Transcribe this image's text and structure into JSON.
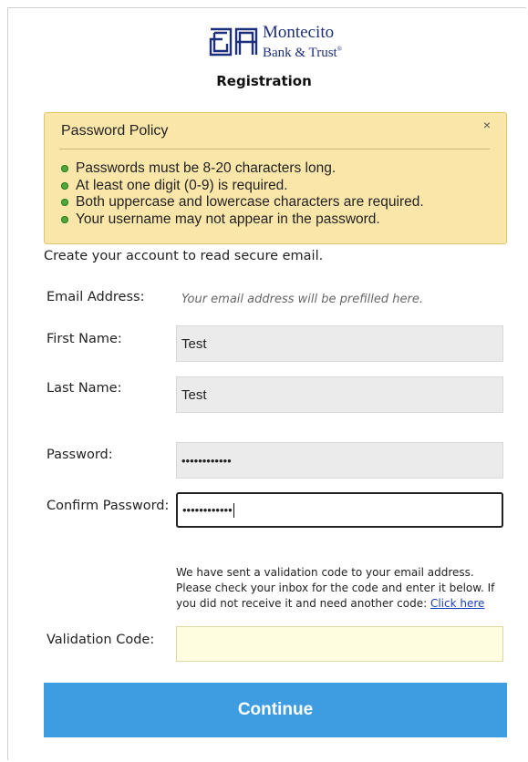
{
  "brand": {
    "line1": "Montecito",
    "line2": "Bank & Trust",
    "registered_mark": "®",
    "color": "#1e2f7a"
  },
  "page_title": "Registration",
  "policy": {
    "title": "Password Policy",
    "close_label": "×",
    "items": [
      "Passwords must be 8-20 characters long.",
      "At least one digit (0-9) is required.",
      "Both uppercase and lowercase characters are required.",
      "Your username may not appear in the password."
    ],
    "background": "#fbe6a9"
  },
  "intro": "Create your account to read secure email.",
  "form": {
    "email_label": "Email Address:",
    "email_hint": "Your email address will be prefilled here.",
    "first_name_label": "First Name:",
    "first_name_value": "Test",
    "last_name_label": "Last Name:",
    "last_name_value": "Test",
    "password_label": "Password:",
    "password_value": "••••••••••••",
    "confirm_label": "Confirm Password:",
    "confirm_value": "••••••••••••",
    "validation_label": "Validation Code:",
    "validation_value": ""
  },
  "notice": {
    "text": "We have sent a validation code to your email address. Please check your inbox for the code and enter it below. If you did not receive it and need another code: ",
    "link": "Click here"
  },
  "continue_label": "Continue",
  "colors": {
    "button": "#3d9de0",
    "link": "#1a3fbf"
  }
}
